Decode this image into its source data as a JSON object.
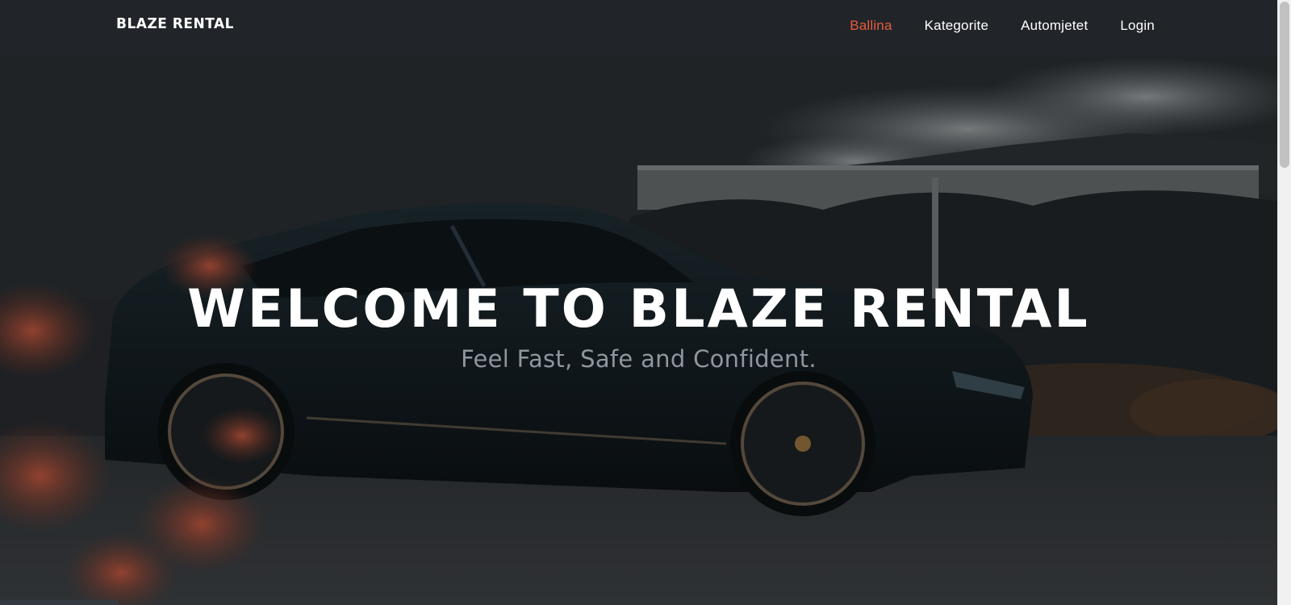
{
  "navbar": {
    "brand": "BLAZE RENTAL",
    "links": [
      {
        "label": "Ballina",
        "active": true
      },
      {
        "label": "Kategorite",
        "active": false
      },
      {
        "label": "Automjetet",
        "active": false
      },
      {
        "label": "Login",
        "active": false
      }
    ]
  },
  "hero": {
    "title": "WELCOME TO BLAZE RENTAL",
    "subtitle": "Feel Fast, Safe and Confident.",
    "background_image": "dark-suv-car-photo"
  },
  "colors": {
    "navbar_bg": "#212529",
    "accent": "#e55b3c",
    "subtitle": "#8e979f",
    "text": "#ffffff"
  }
}
